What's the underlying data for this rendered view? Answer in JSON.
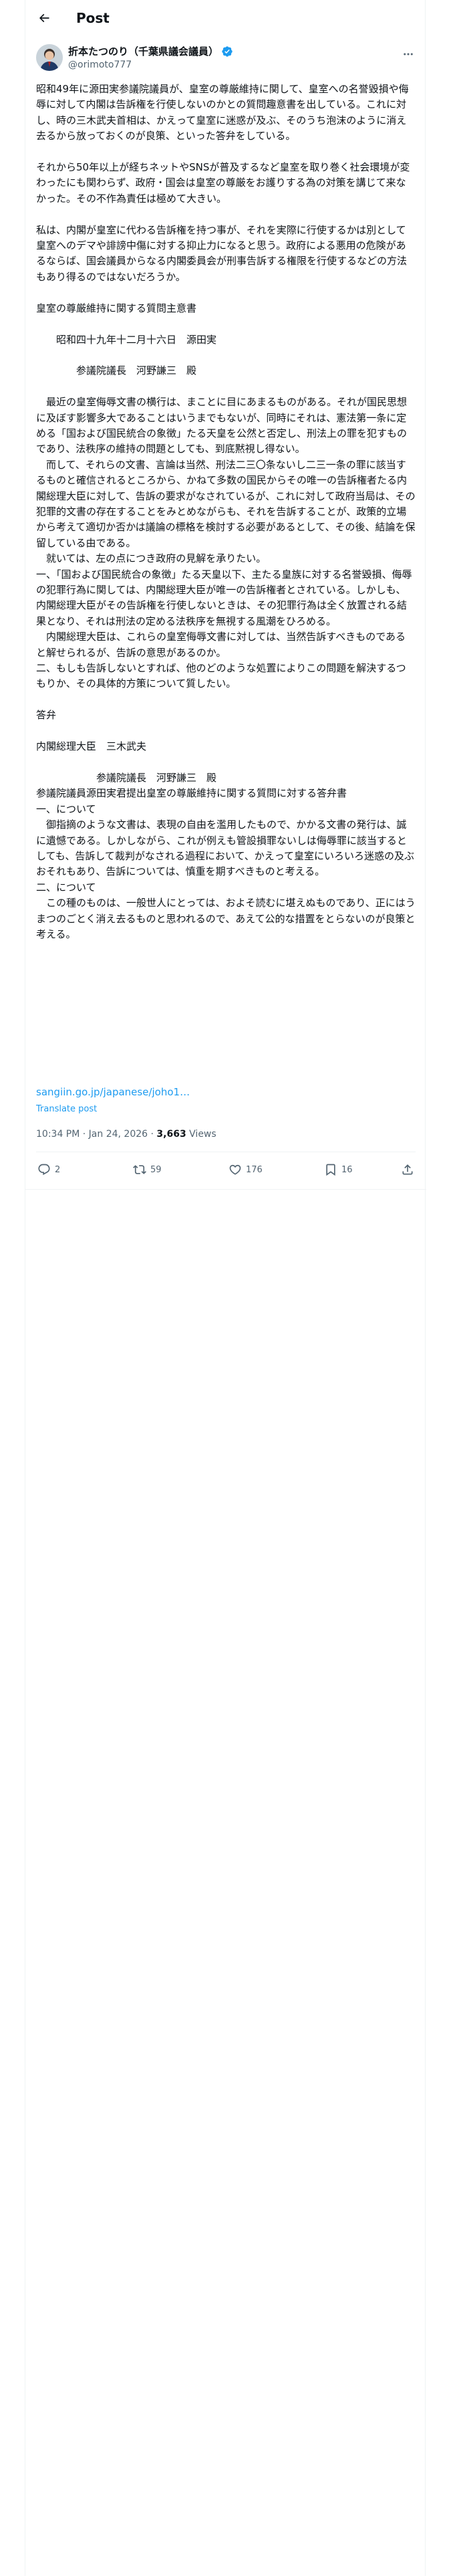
{
  "header": {
    "title": "Post"
  },
  "author": {
    "name": "折本たつのり（千葉県議会議員）",
    "handle": "@orimoto777"
  },
  "post": {
    "text": "昭和49年に源田実参議院議員が、皇室の尊厳維持に関して、皇室への名誉毀損や侮辱に対して内閣は告訴権を行使しないのかとの質問趣意書を出している。これに対し、時の三木武夫首相は、かえって皇室に迷惑が及ぶ、そのうち泡沫のように消え去るから放っておくのが良策、といった答弁をしている。\n\nそれから50年以上が経ちネットやSNSが普及するなど皇室を取り巻く社会環境が変わったにも関わらず、政府・国会は皇室の尊厳をお護りする為の対策を講じて来なかった。その不作為責任は極めて大きい。\n\n私は、内閣が皇室に代わる告訴権を持つ事が、それを実際に行使するかは別として皇室へのデマや誹謗中傷に対する抑止力になると思う。政府による悪用の危険があるならば、国会議員からなる内閣委員会が刑事告訴する権限を行使するなどの方法もあり得るのではないだろうか。\n\n皇室の尊厳維持に関する質問主意書\n\n　　昭和四十九年十二月十六日　源田実\n\n　　　　参議院議長　河野謙三　殿\n\n　最近の皇室侮辱文書の横行は、まことに目にあまるものがある。それが国民思想に及ぼす影響多大であることはいうまでもないが、同時にそれは、憲法第一条に定める「国および国民統合の象徴」たる天皇を公然と否定し、刑法上の罪を犯すものであり、法秩序の維持の問題としても、到底黙視し得ない。\n　而して、それらの文書、言論は当然、刑法二三〇条ないし二三一条の罪に該当するものと確信されるところから、かねて多数の国民からその唯一の告訴権者たる内閣総理大臣に対して、告訴の要求がなされているが、これに対して政府当局は、その犯罪的文書の存在することをみとめながらも、それを告訴することが、政策的立場から考えて適切か否かは議論の標格を検討する必要があるとして、その後、結論を保留している由である。\n　就いては、左の点につき政府の見解を承りたい。\n一、「国および国民統合の象徴」たる天皇以下、主たる皇族に対する名誉毀損、侮辱の犯罪行為に関しては、内閣総理大臣が唯一の告訴権者とされている。しかしも、内閣総理大臣がその告訴権を行使しないときは、その犯罪行為は全く放置される結果となり、それは刑法の定める法秩序を無視する風潮をひろめる。\n　内閣総理大臣は、これらの皇室侮辱文書に対しては、当然告訴すべきものであると解せられるが、告訴の意思があるのか。\n二、もしも告訴しないとすれば、他のどのような処置によりこの問題を解決するつもりか、その具体的方策について質したい。\n\n答弁\n\n内閣総理大臣　三木武夫\n\n　　　　　　参議院議長　河野謙三　殿\n参議院議員源田実君提出皇室の尊厳維持に関する質問に対する答弁書\n一、について\n　御指摘のような文書は、表現の自由を濫用したもので、かかる文書の発行は、誠に遺憾である。しかしながら、これが例えも管設損罪ないしは侮辱罪に該当するとしても、告訴して裁判がなされる過程において、かえって皇室にいろいろ迷惑の及ぶおそれもあり、告訴については、慎重を期すべきものと考える。\n二、について\n　この種のものは、一般世人にとっては、およそ読むに堪えぬものであり、正にはうまつのごとく消え去るものと思われるので、あえて公的な措置をとらないのが良策と考える。"
  },
  "link": {
    "text": "sangiin.go.jp/japanese/joho1…"
  },
  "translate_label": "Translate post",
  "meta": {
    "time": "10:34 PM · Jan 24, 2026",
    "separator": "·",
    "views_count": "3,663",
    "views_label": "Views"
  },
  "actions": {
    "replies": "2",
    "reposts": "59",
    "likes": "176",
    "bookmarks": "16"
  },
  "colors": {
    "accent": "#1d9bf0",
    "secondary_text": "#536471",
    "border": "#eff3f4"
  },
  "icons": [
    "back-arrow-icon",
    "verified-badge-icon",
    "more-icon",
    "reply-icon",
    "repost-icon",
    "like-icon",
    "bookmark-icon",
    "share-icon"
  ]
}
